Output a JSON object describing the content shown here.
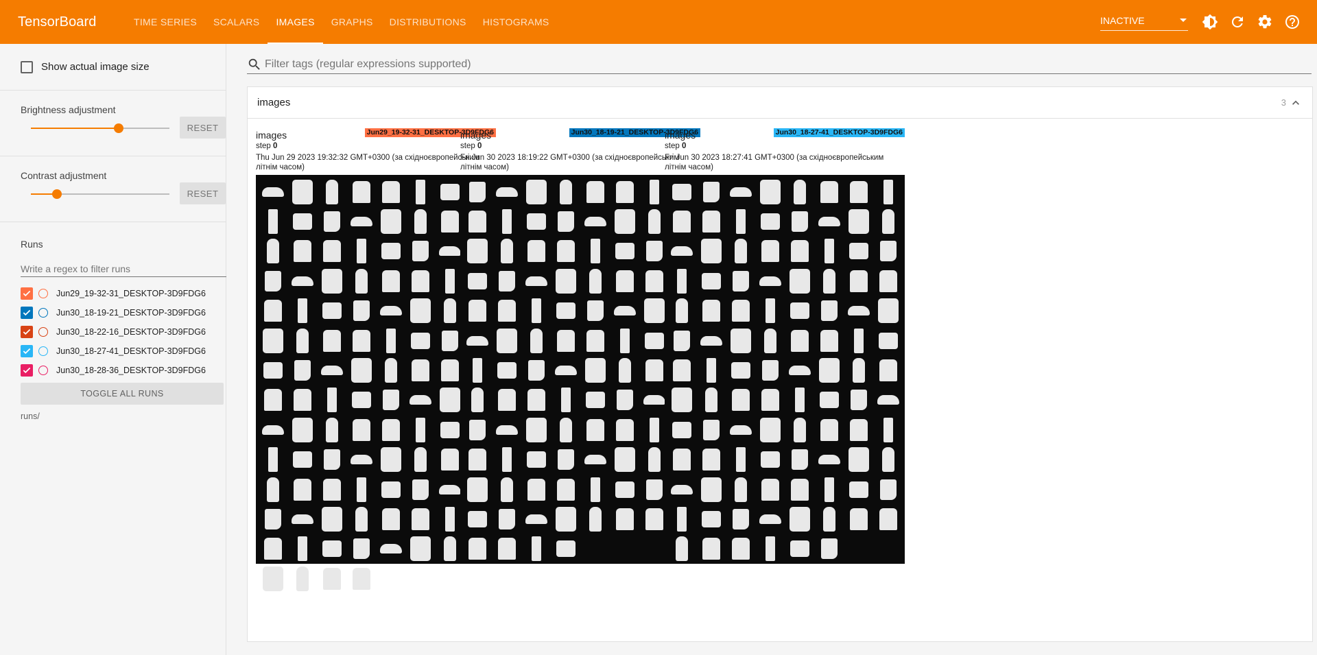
{
  "app": {
    "title": "TensorBoard"
  },
  "nav": {
    "tabs": [
      {
        "label": "TIME SERIES",
        "active": false
      },
      {
        "label": "SCALARS",
        "active": false
      },
      {
        "label": "IMAGES",
        "active": true
      },
      {
        "label": "GRAPHS",
        "active": false
      },
      {
        "label": "DISTRIBUTIONS",
        "active": false
      },
      {
        "label": "HISTOGRAMS",
        "active": false
      }
    ],
    "status": "INACTIVE",
    "icons": [
      "theme-icon",
      "refresh-icon",
      "settings-icon",
      "help-icon"
    ]
  },
  "sidebar": {
    "show_actual_size": "Show actual image size",
    "brightness": {
      "title": "Brightness adjustment",
      "value": 0.635,
      "reset": "RESET"
    },
    "contrast": {
      "title": "Contrast adjustment",
      "value": 0.19,
      "reset": "RESET"
    },
    "runs": {
      "title": "Runs",
      "filter_placeholder": "Write a regex to filter runs",
      "items": [
        {
          "name": "Jun29_19-32-31_DESKTOP-3D9FDG6",
          "color": "#ff7043",
          "checked": true
        },
        {
          "name": "Jun30_18-19-21_DESKTOP-3D9FDG6",
          "color": "#0277bd",
          "checked": true
        },
        {
          "name": "Jun30_18-22-16_DESKTOP-3D9FDG6",
          "color": "#d84315",
          "checked": true
        },
        {
          "name": "Jun30_18-27-41_DESKTOP-3D9FDG6",
          "color": "#29b6f6",
          "checked": true
        },
        {
          "name": "Jun30_18-28-36_DESKTOP-3D9FDG6",
          "color": "#e91e63",
          "checked": true
        }
      ],
      "toggle_all": "TOGGLE ALL RUNS",
      "path": "runs/"
    }
  },
  "main": {
    "filter_placeholder": "Filter tags (regular expressions supported)",
    "card": {
      "title": "images",
      "count": "3",
      "images": [
        {
          "tag": "images",
          "run": "Jun29_19-32-31_DESKTOP-3D9FDG6",
          "run_color": "#ff7043",
          "step_label": "step",
          "step": "0",
          "timestamp": "Thu Jun 29 2023 19:32:32 GMT+0300 (за східноєвропейським літнім часом)"
        },
        {
          "tag": "images",
          "run": "Jun30_18-19-21_DESKTOP-3D9FDG6",
          "run_color": "#0277bd",
          "step_label": "step",
          "step": "0",
          "timestamp": "Fri Jun 30 2023 18:19:22 GMT+0300 (за східноєвропейським літнім часом)"
        },
        {
          "tag": "images",
          "run": "Jun30_18-27-41_DESKTOP-3D9FDG6",
          "run_color": "#29b6f6",
          "step_label": "step",
          "step": "0",
          "timestamp": "Fri Jun 30 2023 18:27:41 GMT+0300 (за східноєвропейським літнім часом)"
        }
      ]
    }
  }
}
